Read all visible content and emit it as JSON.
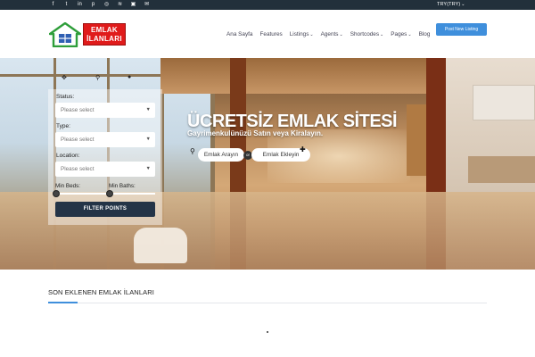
{
  "topbar": {
    "social_icons": [
      {
        "icon": "facebook-icon",
        "glyph": "f"
      },
      {
        "icon": "twitter-icon",
        "glyph": "t"
      },
      {
        "icon": "linkedin-icon",
        "glyph": "in"
      },
      {
        "icon": "pinterest-icon",
        "glyph": "p"
      },
      {
        "icon": "instagram-icon",
        "glyph": "◎"
      },
      {
        "icon": "rss-icon",
        "glyph": "≋"
      },
      {
        "icon": "skype-icon",
        "glyph": "▣"
      },
      {
        "icon": "email-icon",
        "glyph": "✉"
      }
    ],
    "currency": "TRY(TRY)"
  },
  "header": {
    "logo_line1": "EMLAK",
    "logo_line2": "İLANLARI",
    "nav": [
      {
        "label": "Ana Sayfa",
        "dropdown": false
      },
      {
        "label": "Features",
        "dropdown": false
      },
      {
        "label": "Listings",
        "dropdown": true
      },
      {
        "label": "Agents",
        "dropdown": true
      },
      {
        "label": "Shortcodes",
        "dropdown": true
      },
      {
        "label": "Pages",
        "dropdown": true
      },
      {
        "label": "Blog",
        "dropdown": false
      }
    ],
    "post_button": "Post New Listing"
  },
  "search": {
    "status_label": "Status:",
    "status_placeholder": "Please select",
    "type_label": "Type:",
    "type_placeholder": "Please select",
    "location_label": "Location:",
    "location_placeholder": "Please select",
    "min_beds_label": "Min Beds:",
    "min_baths_label": "Min Baths:",
    "filter_button": "FILTER POINTS"
  },
  "hero": {
    "title": "ÜCRETSİZ EMLAK SİTESİ",
    "subtitle": "Gayrimenkulünüzü Satın veya Kiralayın.",
    "search_button": "Emlak Arayın",
    "or_label": "or",
    "add_button": "Emlak Ekleyin"
  },
  "section": {
    "title": "SON EKLENEN EMLAK İLANLARI"
  },
  "colors": {
    "topbar": "#22303b",
    "accent": "#3f8fdc",
    "logo_red": "#e01b1b",
    "filter_button": "#243447"
  }
}
